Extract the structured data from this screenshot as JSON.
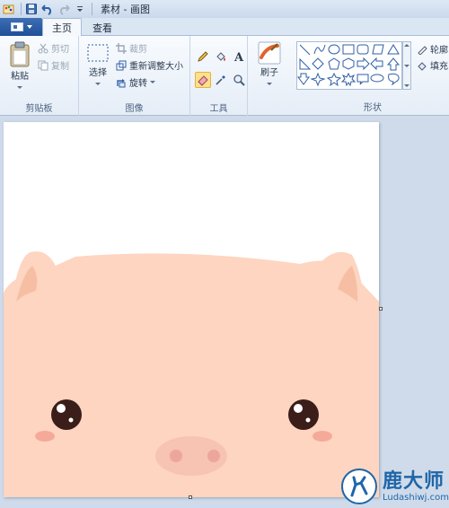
{
  "window": {
    "title": "素材 - 画图"
  },
  "tabs": [
    {
      "label": "主页",
      "active": true
    },
    {
      "label": "查看",
      "active": false
    }
  ],
  "clipboard": {
    "group_label": "剪贴板",
    "paste_label": "粘贴",
    "cut_label": "剪切",
    "copy_label": "复制"
  },
  "image": {
    "group_label": "图像",
    "select_label": "选择",
    "crop_label": "裁剪",
    "resize_label": "重新调整大小",
    "rotate_label": "旋转"
  },
  "tools": {
    "group_label": "工具",
    "items": [
      "pencil-icon",
      "fill-icon",
      "text-icon",
      "eraser-icon",
      "color-picker-icon",
      "magnifier-icon"
    ],
    "selected": "eraser-icon"
  },
  "brushes": {
    "label": "刷子"
  },
  "shapes": {
    "group_label": "形状",
    "outline_label": "轮廓",
    "fill_label": "填充"
  },
  "canvas": {
    "background": "#ffffff",
    "subject_color": "#fdd5c0",
    "ear_inner_color": "#f6bfa4",
    "cheek_color": "#f5aa99",
    "snout_color": "#f7c3b3",
    "nostril_color": "#eca79a",
    "eye_color": "#3b1e1a"
  },
  "watermark": {
    "text": "鹿大师",
    "subtext": "Ludashiwj.com"
  },
  "colors": {
    "file_tab": "#2a5ca5",
    "ribbon_bg": "#f3f7fc",
    "workspace_bg": "#cfdbea",
    "selected_tool": "#fde08c"
  }
}
